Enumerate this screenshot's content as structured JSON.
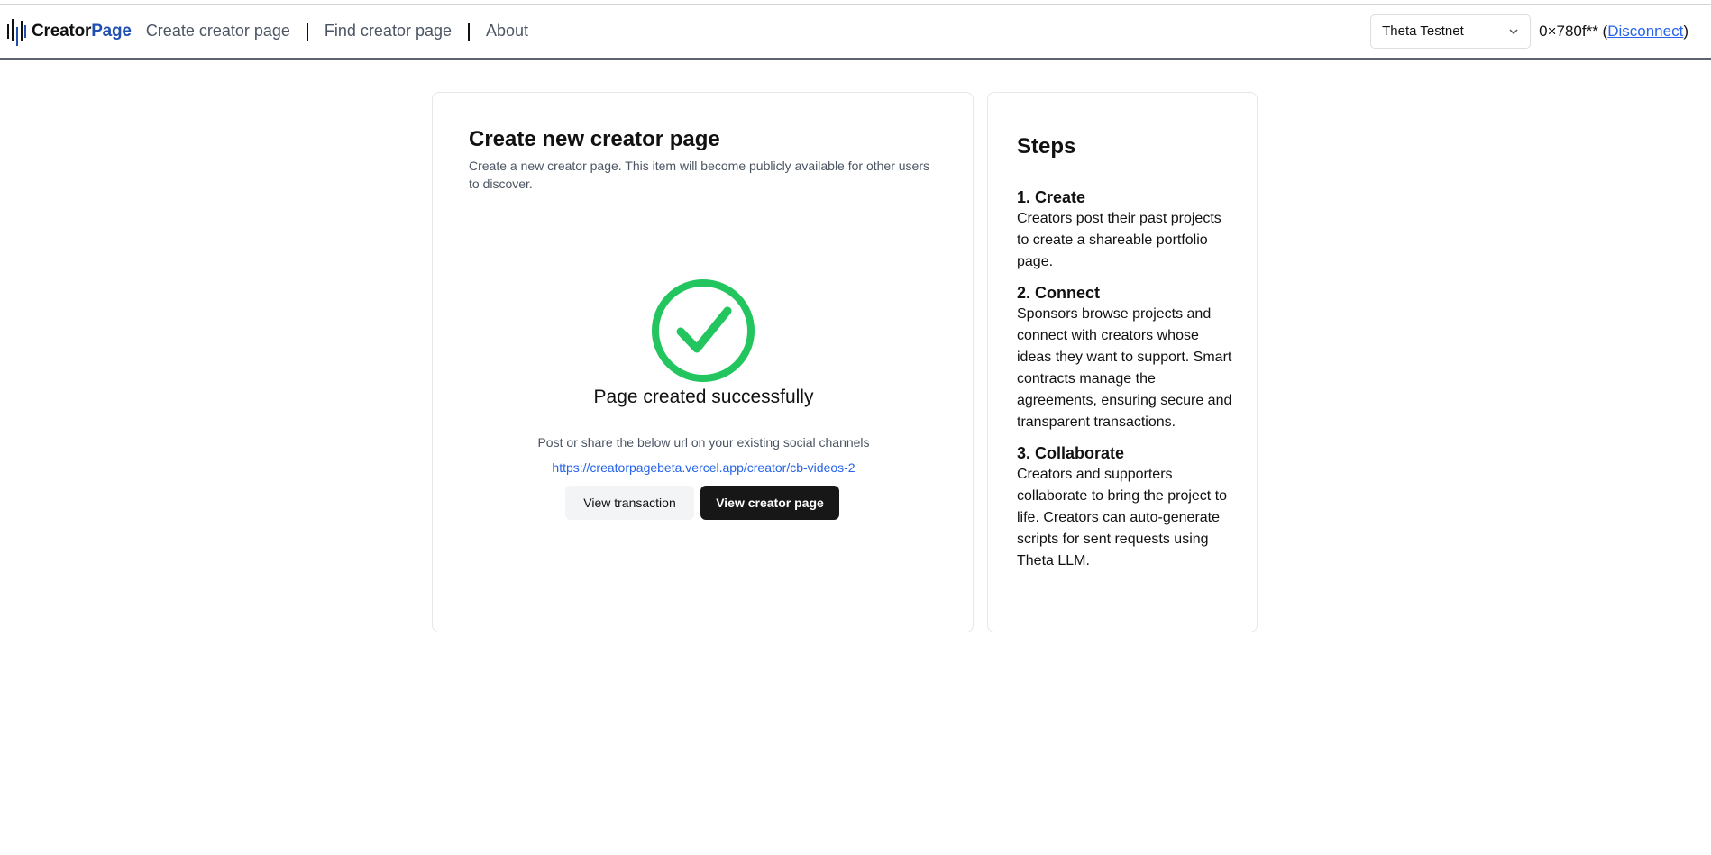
{
  "header": {
    "brand": {
      "word1": "Creator",
      "word2": "Page"
    },
    "nav": [
      {
        "label": "Create creator page"
      },
      {
        "label": "Find creator page"
      },
      {
        "label": "About"
      }
    ],
    "network_select": {
      "value": "Theta Testnet"
    },
    "account": {
      "address": "0×780f**",
      "disconnect_label": "Disconnect"
    }
  },
  "main": {
    "title": "Create new creator page",
    "description": "Create a new creator page. This item will become publicly available for other users to discover.",
    "success_text": "Page created successfully",
    "share_text": "Post or share the below url on your existing social channels",
    "share_url": "https://creatorpagebeta.vercel.app/creator/cb-videos-2",
    "view_transaction_label": "View transaction",
    "view_page_label": "View creator page"
  },
  "steps": {
    "title": "Steps",
    "items": [
      {
        "heading": "1. Create",
        "body": "Creators post their past projects to create a shareable portfolio page."
      },
      {
        "heading": "2. Connect",
        "body": "Sponsors browse projects and connect with creators whose ideas they want to support. Smart contracts manage the agreements, ensuring secure and transparent transactions."
      },
      {
        "heading": "3. Collaborate",
        "body": "Creators and supporters collaborate to bring the project to life. Creators can auto-generate scripts for sent requests using Theta LLM."
      }
    ]
  },
  "colors": {
    "brand_blue": "#1f4fb0",
    "success_green": "#22c55e",
    "link_blue": "#2563eb",
    "primary_button": "#171717"
  },
  "icons": {
    "logo": "bars-logo-icon",
    "select_caret": "chevron-down-icon",
    "success": "check-circle-icon"
  }
}
